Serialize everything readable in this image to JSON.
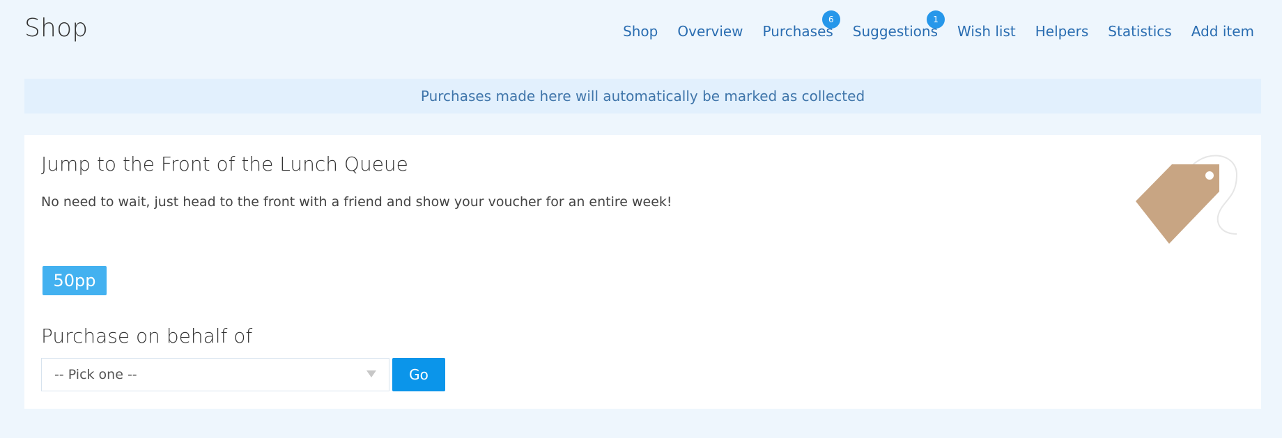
{
  "header": {
    "title": "Shop",
    "nav": [
      {
        "label": "Shop"
      },
      {
        "label": "Overview"
      },
      {
        "label": "Purchases",
        "badge": "6"
      },
      {
        "label": "Suggestions",
        "badge": "1"
      },
      {
        "label": "Wish list"
      },
      {
        "label": "Helpers"
      },
      {
        "label": "Statistics"
      },
      {
        "label": "Add item"
      }
    ]
  },
  "notice": {
    "text": "Purchases made here will automatically be marked as collected"
  },
  "item": {
    "title": "Jump to the Front of the Lunch Queue",
    "description": "No need to wait, just head to the front with a friend and show your voucher for an entire week!",
    "price": "50pp",
    "icon": "tag-icon"
  },
  "purchase": {
    "title": "Purchase on behalf of",
    "select_value": "-- Pick one --",
    "go_label": "Go"
  },
  "colors": {
    "background": "#eef6fd",
    "accent": "#0b95ea",
    "badge": "#2697ea",
    "tag": "#c8a583"
  }
}
